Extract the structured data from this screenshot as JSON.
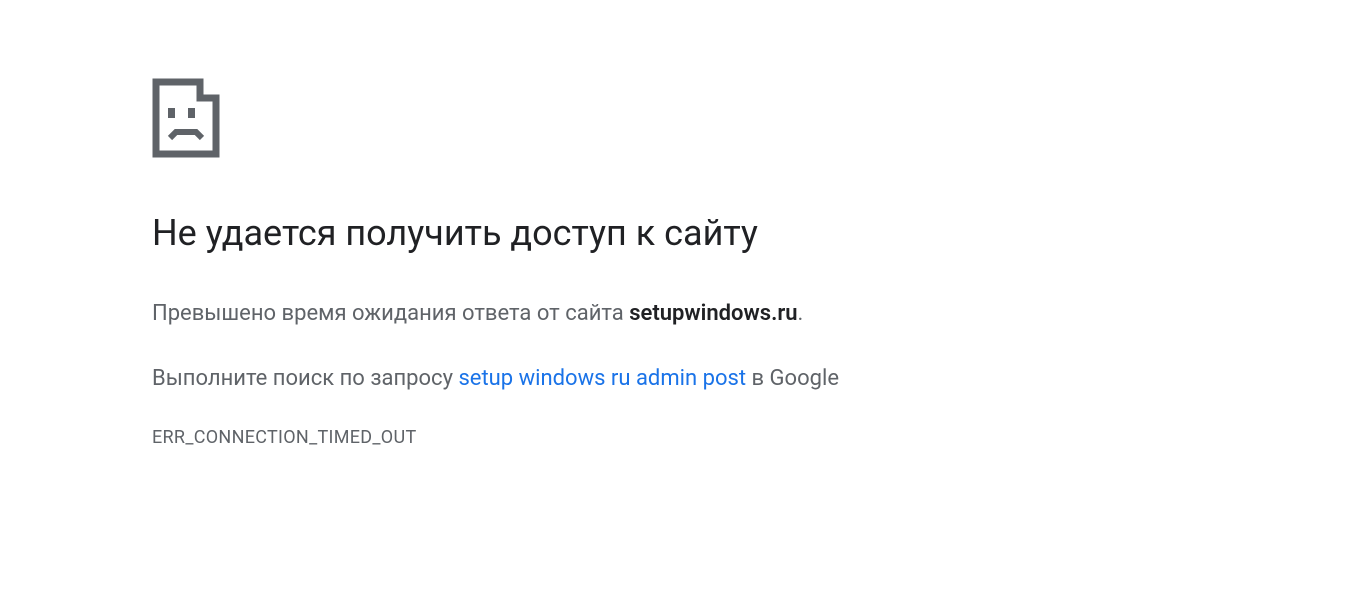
{
  "error": {
    "heading": "Не удается получить доступ к сайту",
    "timeout_prefix": "Превышено время ожидания ответа от сайта ",
    "domain": "setupwindows.ru",
    "timeout_suffix": ".",
    "search_prefix": "Выполните поиск по запросу ",
    "search_query": "setup windows ru admin post",
    "search_suffix": " в Google",
    "error_code": "ERR_CONNECTION_TIMED_OUT"
  }
}
